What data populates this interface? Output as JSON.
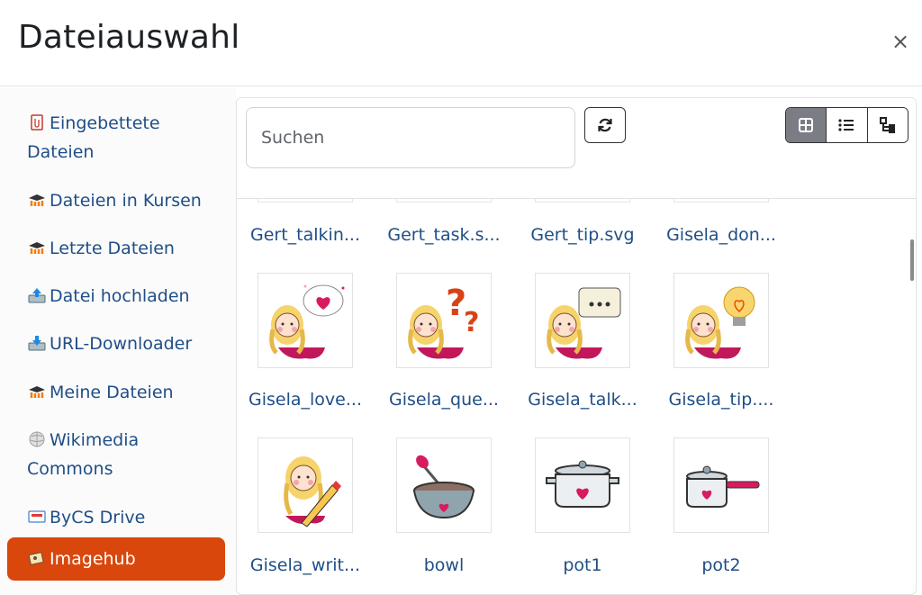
{
  "dialog": {
    "title": "Dateiauswahl",
    "close_label": "×"
  },
  "sidebar": {
    "items": [
      {
        "label": "Eingebettete Dateien",
        "icon": "embedded-files-icon",
        "active": false
      },
      {
        "label": "Dateien in Kursen",
        "icon": "moodle-icon",
        "active": false
      },
      {
        "label": "Letzte Dateien",
        "icon": "moodle-icon",
        "active": false
      },
      {
        "label": "Datei hochladen",
        "icon": "upload-icon",
        "active": false
      },
      {
        "label": "URL-Downloader",
        "icon": "download-icon",
        "active": false
      },
      {
        "label": "Meine Dateien",
        "icon": "moodle-icon",
        "active": false
      },
      {
        "label": "Wikimedia Commons",
        "icon": "wikimedia-icon",
        "active": false
      },
      {
        "label": "ByCS Drive",
        "icon": "drive-icon",
        "active": false
      },
      {
        "label": "Imagehub",
        "icon": "imagehub-icon",
        "active": true
      }
    ]
  },
  "toolbar": {
    "search_placeholder": "Suchen",
    "refresh_icon": "refresh-icon",
    "views": [
      {
        "name": "icons-view",
        "active": true
      },
      {
        "name": "list-view",
        "active": false
      },
      {
        "name": "tree-view",
        "active": false
      }
    ]
  },
  "files": {
    "row1": [
      "Gert_talkin...",
      "Gert_task.s...",
      "Gert_tip.svg",
      "Gisela_don..."
    ],
    "row2": [
      "Gisela_love...",
      "Gisela_que...",
      "Gisela_talk...",
      "Gisela_tip...."
    ],
    "row3": [
      "Gisela_writ...",
      "bowl",
      "pot1",
      "pot2"
    ]
  },
  "colors": {
    "accent": "#d9470d",
    "link": "#1f4e86",
    "active_view": "#7b7d85"
  }
}
